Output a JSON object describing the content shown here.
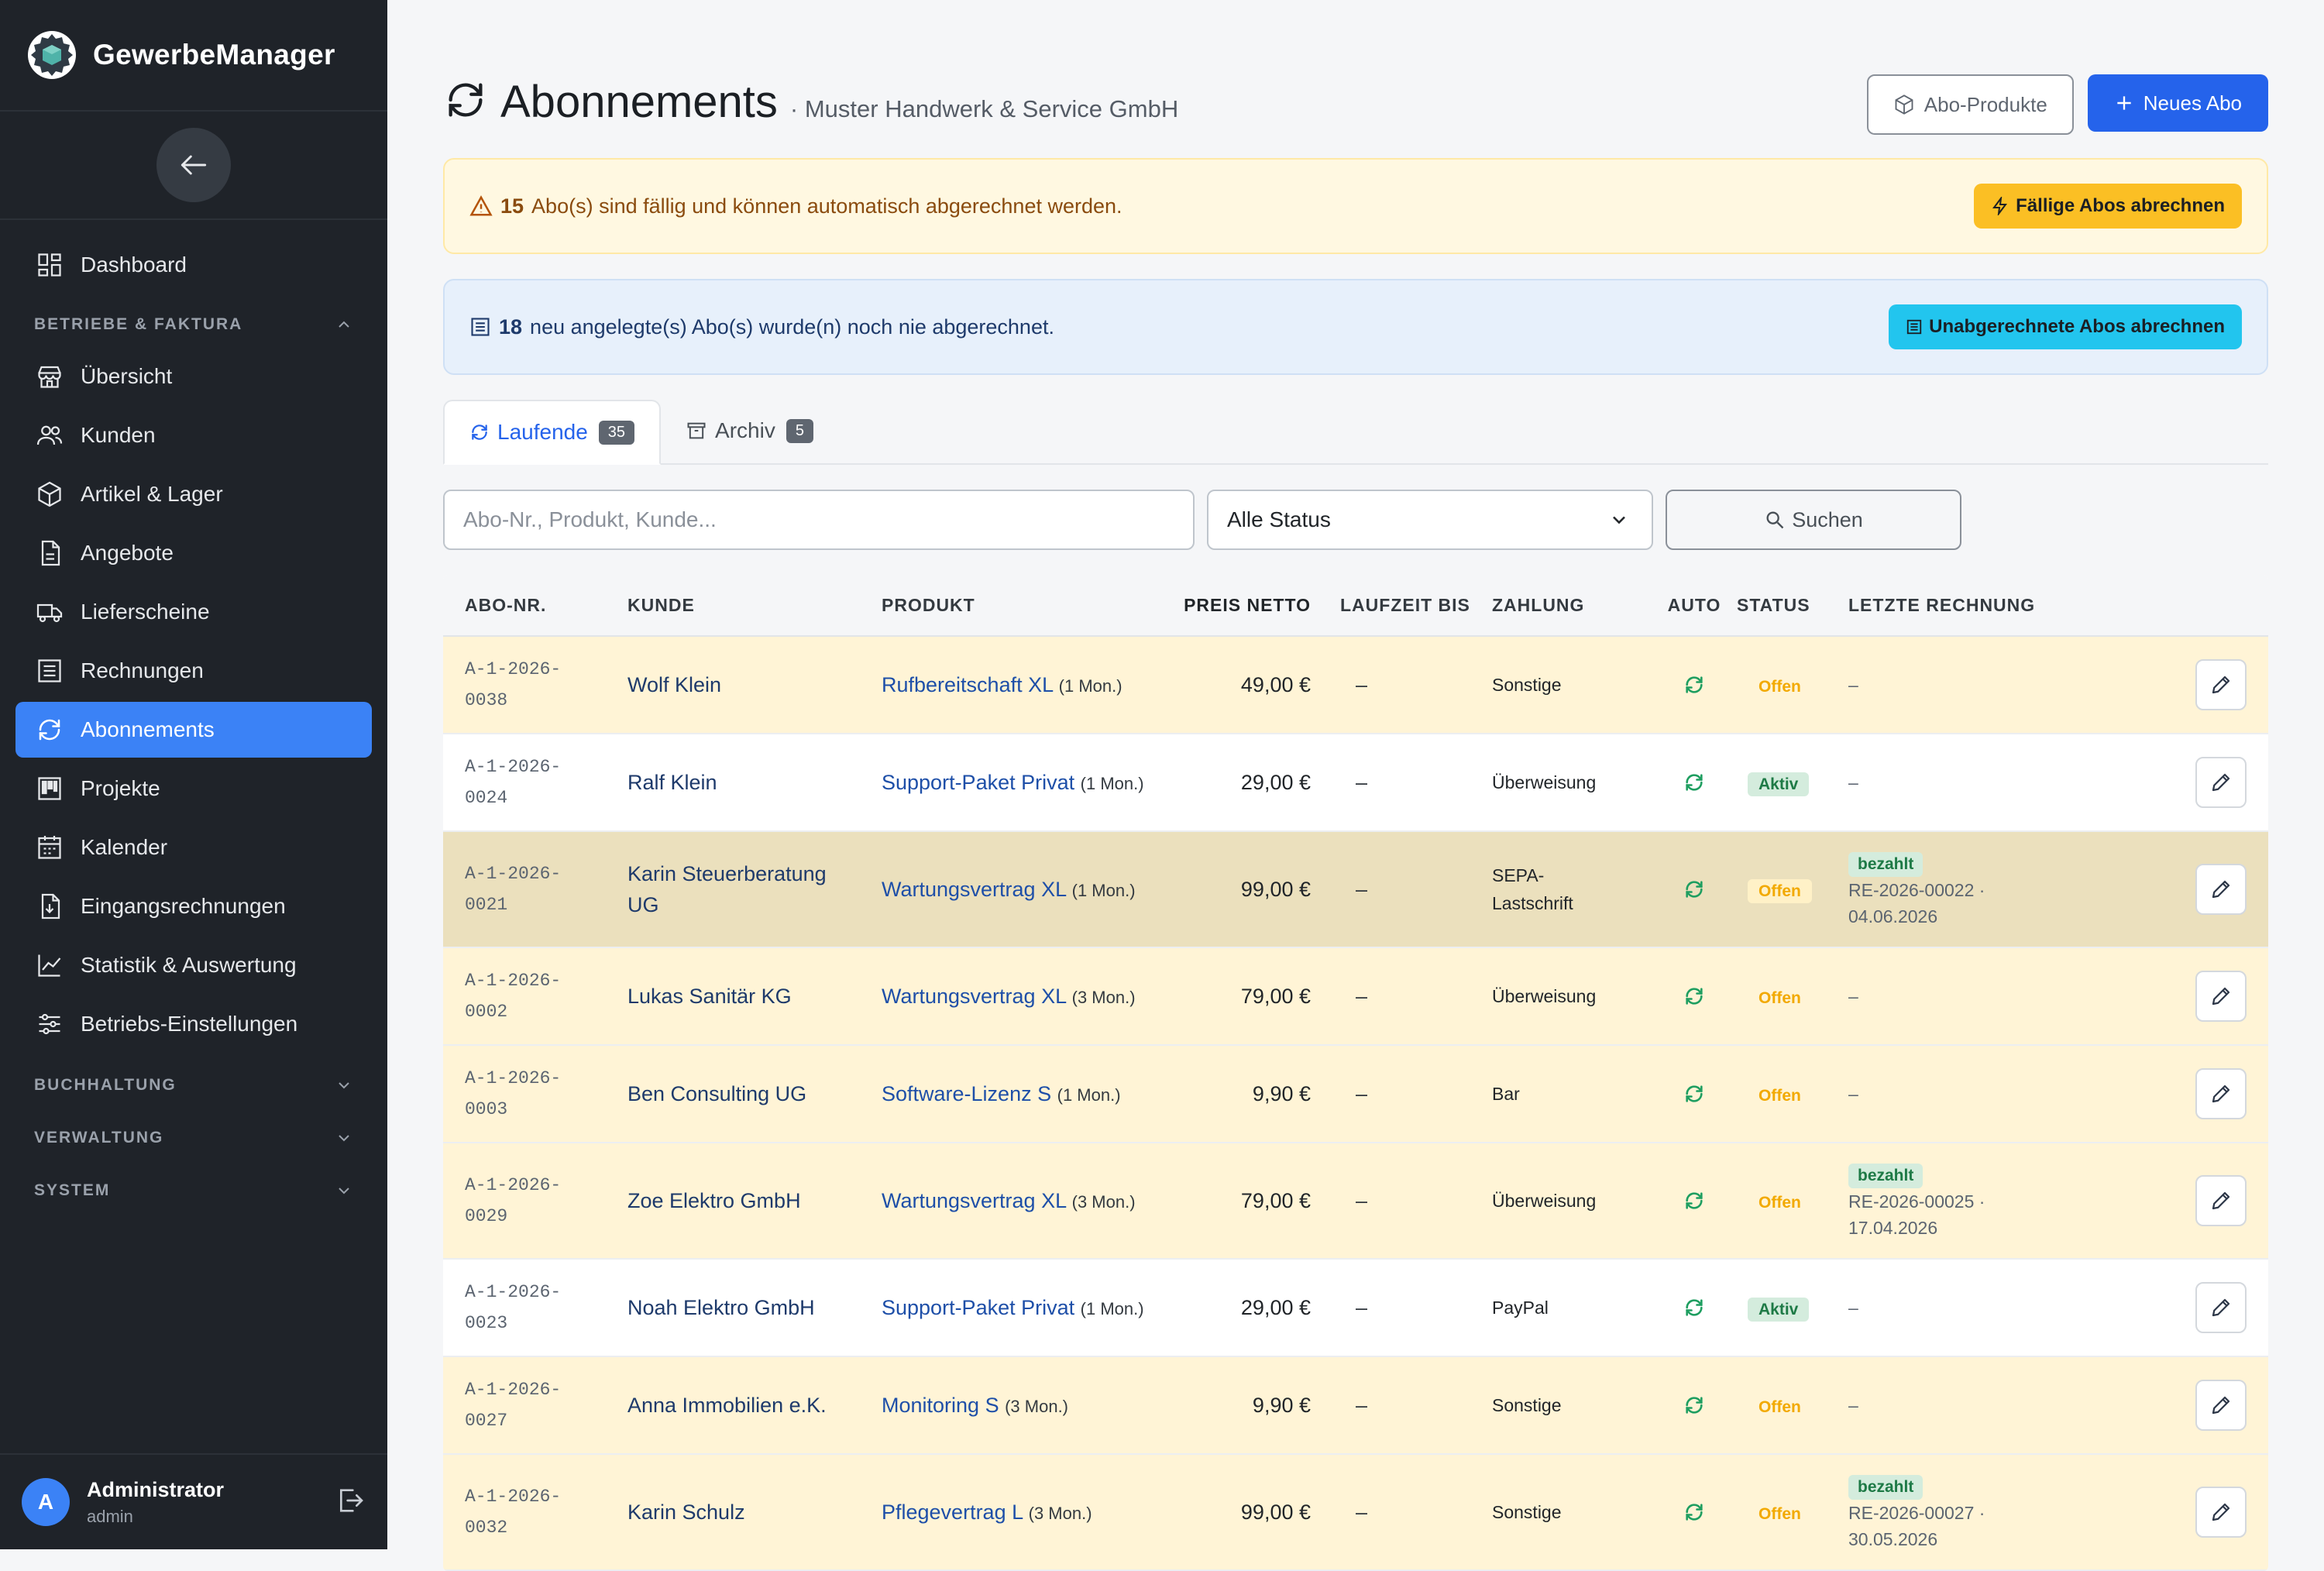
{
  "colors": {
    "sidebar_bg": "#1f2329",
    "accent": "#3b82f6",
    "primary_button": "#2563eb",
    "warn_bg": "#fff8e1",
    "warn_button": "#fbbf24",
    "info_bg": "#e7f0fb",
    "info_button": "#22c5ee",
    "status_offen": "#f2a900",
    "status_aktiv": "#1e7a46"
  },
  "sidebar": {
    "brand": "GewerbeManager",
    "brand_icon": "gear-cube-logo",
    "back_icon": "arrow-left-icon",
    "items_top": [
      {
        "label": "Dashboard",
        "icon": "dashboard-icon"
      }
    ],
    "section_betriebe": "BETRIEBE & FAKTURA",
    "items": [
      {
        "label": "Übersicht",
        "icon": "store-icon"
      },
      {
        "label": "Kunden",
        "icon": "users-icon"
      },
      {
        "label": "Artikel & Lager",
        "icon": "box-icon"
      },
      {
        "label": "Angebote",
        "icon": "document-icon"
      },
      {
        "label": "Lieferscheine",
        "icon": "truck-icon"
      },
      {
        "label": "Rechnungen",
        "icon": "receipt-icon"
      },
      {
        "label": "Abonnements",
        "icon": "refresh-icon",
        "active": true
      },
      {
        "label": "Projekte",
        "icon": "kanban-icon"
      },
      {
        "label": "Kalender",
        "icon": "calendar-icon"
      },
      {
        "label": "Eingangsrechnungen",
        "icon": "file-download-icon"
      },
      {
        "label": "Statistik & Auswertung",
        "icon": "chart-line-icon"
      },
      {
        "label": "Betriebs-Einstellungen",
        "icon": "sliders-icon"
      }
    ],
    "sections_collapsed": [
      "BUCHHALTUNG",
      "VERWALTUNG",
      "SYSTEM"
    ],
    "user": {
      "initial": "A",
      "name": "Administrator",
      "role": "admin"
    }
  },
  "header": {
    "title": "Abonnements",
    "subtitle": "· Muster Handwerk & Service GmbH",
    "btn_products": "Abo-Produkte",
    "btn_new": "Neues Abo"
  },
  "alerts": {
    "due": {
      "count": "15",
      "text": "Abo(s) sind fällig und können automatisch abgerechnet werden.",
      "button": "Fällige Abos abrechnen"
    },
    "never": {
      "count": "18",
      "text": "neu angelegte(s) Abo(s) wurde(n) noch nie abgerechnet.",
      "button": "Unabgerechnete Abos abrechnen"
    }
  },
  "tabs": [
    {
      "label": "Laufende",
      "count": "35"
    },
    {
      "label": "Archiv",
      "count": "5"
    }
  ],
  "filters": {
    "search_placeholder": "Abo-Nr., Produkt, Kunde...",
    "search_value": "",
    "status_selected": "Alle Status",
    "search_button": "Suchen"
  },
  "table": {
    "headers": {
      "abo": "ABO-NR.",
      "kunde": "KUNDE",
      "produkt": "PRODUKT",
      "preis": "PREIS NETTO",
      "laufzeit": "LAUFZEIT BIS",
      "zahlung": "ZAHLUNG",
      "auto": "AUTO",
      "status": "STATUS",
      "letzte": "LETZTE RECHNUNG"
    },
    "rows": [
      {
        "abo1": "A-1-2026-",
        "abo2": "0038",
        "kunde1": "Wolf Klein",
        "kunde2": "",
        "produkt": "Rufbereitschaft XL",
        "interval": "(1 Mon.)",
        "preis": "49,00 €",
        "laufzeit": "–",
        "zahlung1": "Sonstige",
        "zahlung2": "",
        "status": "Offen",
        "paid": "",
        "letzte1": "–",
        "letzte2": "",
        "tone": "yellow"
      },
      {
        "abo1": "A-1-2026-",
        "abo2": "0024",
        "kunde1": "Ralf Klein",
        "kunde2": "",
        "produkt": "Support-Paket Privat",
        "interval": "(1 Mon.)",
        "preis": "29,00 €",
        "laufzeit": "–",
        "zahlung1": "Überweisung",
        "zahlung2": "",
        "status": "Aktiv",
        "paid": "",
        "letzte1": "–",
        "letzte2": "",
        "tone": "white"
      },
      {
        "abo1": "A-1-2026-",
        "abo2": "0021",
        "kunde1": "Karin Steuerberatung",
        "kunde2": "UG",
        "produkt": "Wartungsvertrag XL",
        "interval": "(1 Mon.)",
        "preis": "99,00 €",
        "laufzeit": "–",
        "zahlung1": "SEPA-",
        "zahlung2": "Lastschrift",
        "status": "Offen",
        "paid": "bezahlt",
        "letzte1": "RE-2026-00022 ·",
        "letzte2": "04.06.2026",
        "tone": "dark"
      },
      {
        "abo1": "A-1-2026-",
        "abo2": "0002",
        "kunde1": "Lukas Sanitär KG",
        "kunde2": "",
        "produkt": "Wartungsvertrag XL",
        "interval": "(3 Mon.)",
        "preis": "79,00 €",
        "laufzeit": "–",
        "zahlung1": "Überweisung",
        "zahlung2": "",
        "status": "Offen",
        "paid": "",
        "letzte1": "–",
        "letzte2": "",
        "tone": "yellow"
      },
      {
        "abo1": "A-1-2026-",
        "abo2": "0003",
        "kunde1": "Ben Consulting UG",
        "kunde2": "",
        "produkt": "Software-Lizenz S",
        "interval": "(1 Mon.)",
        "preis": "9,90 €",
        "laufzeit": "–",
        "zahlung1": "Bar",
        "zahlung2": "",
        "status": "Offen",
        "paid": "",
        "letzte1": "–",
        "letzte2": "",
        "tone": "yellow"
      },
      {
        "abo1": "A-1-2026-",
        "abo2": "0029",
        "kunde1": "Zoe Elektro GmbH",
        "kunde2": "",
        "produkt": "Wartungsvertrag XL",
        "interval": "(3 Mon.)",
        "preis": "79,00 €",
        "laufzeit": "–",
        "zahlung1": "Überweisung",
        "zahlung2": "",
        "status": "Offen",
        "paid": "bezahlt",
        "letzte1": "RE-2026-00025 ·",
        "letzte2": "17.04.2026",
        "tone": "yellow"
      },
      {
        "abo1": "A-1-2026-",
        "abo2": "0023",
        "kunde1": "Noah Elektro GmbH",
        "kunde2": "",
        "produkt": "Support-Paket Privat",
        "interval": "(1 Mon.)",
        "preis": "29,00 €",
        "laufzeit": "–",
        "zahlung1": "PayPal",
        "zahlung2": "",
        "status": "Aktiv",
        "paid": "",
        "letzte1": "–",
        "letzte2": "",
        "tone": "white"
      },
      {
        "abo1": "A-1-2026-",
        "abo2": "0027",
        "kunde1": "Anna Immobilien e.K.",
        "kunde2": "",
        "produkt": "Monitoring S",
        "interval": "(3 Mon.)",
        "preis": "9,90 €",
        "laufzeit": "–",
        "zahlung1": "Sonstige",
        "zahlung2": "",
        "status": "Offen",
        "paid": "",
        "letzte1": "–",
        "letzte2": "",
        "tone": "yellow"
      },
      {
        "abo1": "A-1-2026-",
        "abo2": "0032",
        "kunde1": "Karin Schulz",
        "kunde2": "",
        "produkt": "Pflegevertrag L",
        "interval": "(3 Mon.)",
        "preis": "99,00 €",
        "laufzeit": "–",
        "zahlung1": "Sonstige",
        "zahlung2": "",
        "status": "Offen",
        "paid": "bezahlt",
        "letzte1": "RE-2026-00027 ·",
        "letzte2": "30.05.2026",
        "tone": "yellow"
      }
    ]
  }
}
